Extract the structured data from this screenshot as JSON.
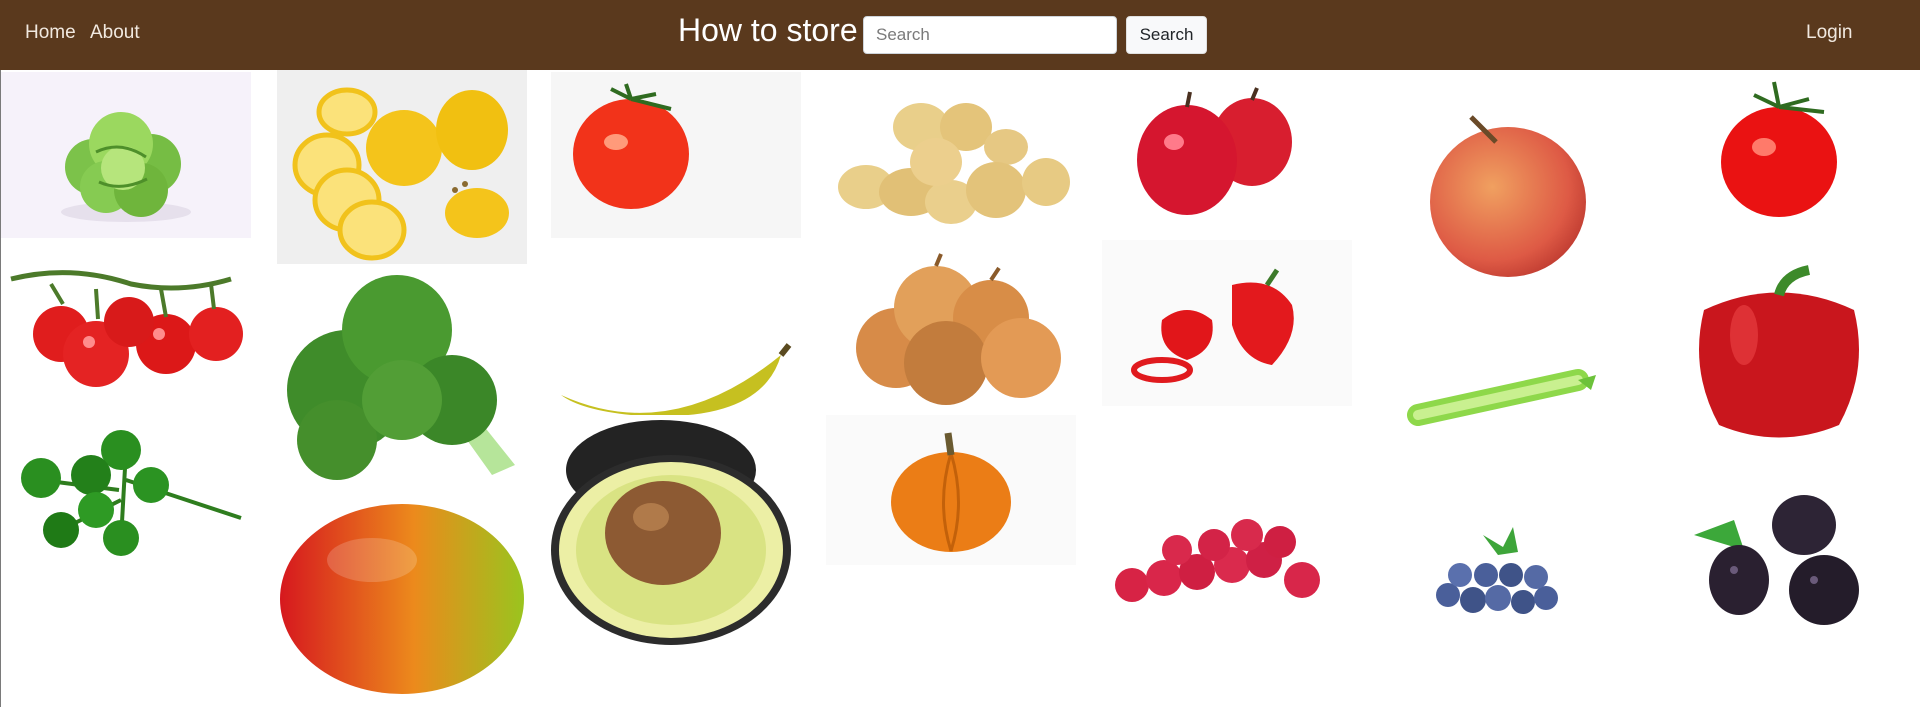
{
  "nav": {
    "home": "Home",
    "about": "About",
    "brand": "How to store",
    "search_placeholder": "Search",
    "search_button": "Search",
    "login": "Login"
  },
  "colors": {
    "navbar": "#5a391d",
    "nav_text": "#f1e9e0"
  },
  "gallery": [
    {
      "name": "lettuce",
      "icon": "lettuce-image"
    },
    {
      "name": "lemons",
      "icon": "lemons-image"
    },
    {
      "name": "tomato",
      "icon": "tomato-image"
    },
    {
      "name": "potatoes",
      "icon": "potatoes-image"
    },
    {
      "name": "apples",
      "icon": "apples-image"
    },
    {
      "name": "apple",
      "icon": "apple-image"
    },
    {
      "name": "tomato",
      "icon": "tomato-image"
    },
    {
      "name": "cherry-tomatoes",
      "icon": "cherry-tomatoes-image"
    },
    {
      "name": "broccoli",
      "icon": "broccoli-image"
    },
    {
      "name": "banana",
      "icon": "banana-image"
    },
    {
      "name": "onions",
      "icon": "onions-image"
    },
    {
      "name": "red-peppers",
      "icon": "red-peppers-image"
    },
    {
      "name": "celery",
      "icon": "celery-image"
    },
    {
      "name": "red-bell-pepper",
      "icon": "red-bell-pepper-image"
    },
    {
      "name": "parsley",
      "icon": "parsley-image"
    },
    {
      "name": "avocado",
      "icon": "avocado-image"
    },
    {
      "name": "pumpkin",
      "icon": "pumpkin-image"
    },
    {
      "name": "raspberries",
      "icon": "raspberries-image"
    },
    {
      "name": "blueberries",
      "icon": "blueberries-image"
    },
    {
      "name": "blackberries",
      "icon": "blackberries-image"
    },
    {
      "name": "mango",
      "icon": "mango-image"
    }
  ]
}
